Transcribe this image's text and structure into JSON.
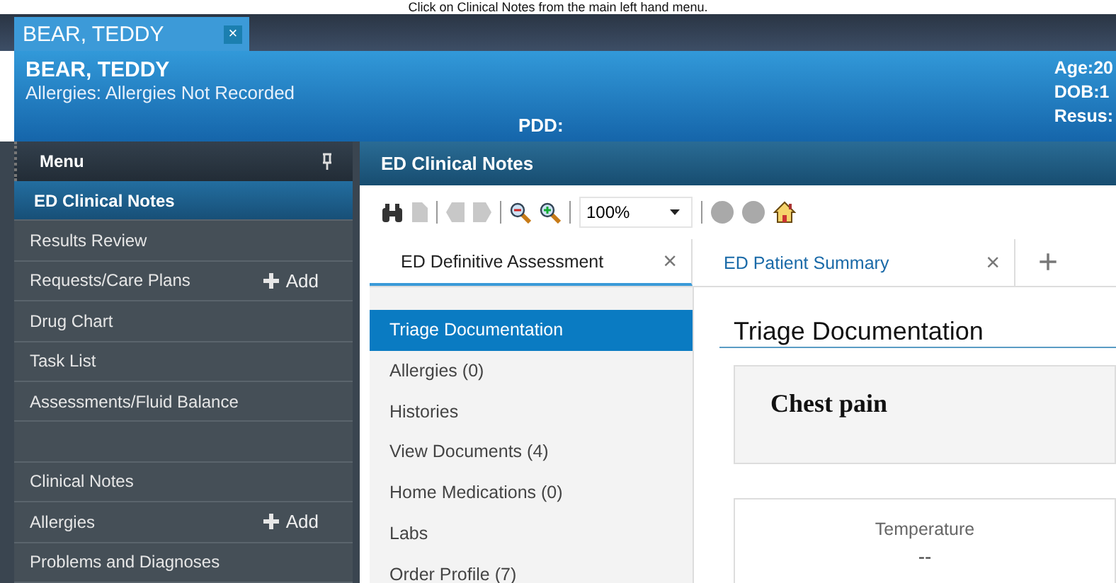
{
  "caption": "Click on Clinical Notes from the main left hand menu.",
  "patient_tab": {
    "label": "BEAR, TEDDY",
    "close": "×"
  },
  "banner": {
    "name": "BEAR, TEDDY",
    "allergies": "Allergies: Allergies Not Recorded",
    "pdd": "PDD:",
    "details": [
      "Age:20",
      "DOB:1",
      "Resus:"
    ]
  },
  "menu": {
    "title": "Menu",
    "groups": [
      {
        "items": [
          {
            "label": "ED Clinical Notes",
            "selected": true
          },
          {
            "label": "Results Review",
            "selected": false
          },
          {
            "label": "Requests/Care Plans",
            "selected": false,
            "add": "Add"
          },
          {
            "label": "Drug Chart",
            "selected": false
          },
          {
            "label": "Task List",
            "selected": false
          },
          {
            "label": "Assessments/Fluid Balance",
            "selected": false
          }
        ]
      },
      {
        "items": [
          {
            "label": "Clinical Notes",
            "selected": false
          },
          {
            "label": "Allergies",
            "selected": false,
            "add": "Add"
          },
          {
            "label": "Problems and Diagnoses",
            "selected": false
          }
        ]
      }
    ]
  },
  "content": {
    "title": "ED Clinical Notes",
    "zoom": "100%",
    "tabs": [
      {
        "label": "ED Definitive Assessment",
        "close": "×",
        "selected": true
      },
      {
        "label": "ED Patient Summary",
        "close": "×",
        "selected": false
      }
    ],
    "new_tab": "+",
    "nav": [
      {
        "label": "Triage Documentation",
        "selected": true
      },
      {
        "label": "Allergies (0)",
        "selected": false
      },
      {
        "label": "Histories",
        "selected": false
      },
      {
        "label": "View Documents (4)",
        "selected": false
      },
      {
        "label": "Home Medications (0)",
        "selected": false
      },
      {
        "label": "Labs",
        "selected": false
      },
      {
        "label": "Order Profile (7)",
        "selected": false
      }
    ],
    "heading": "Triage Documentation",
    "complaint": "Chest pain",
    "vital": {
      "label": "Temperature",
      "value": "--"
    }
  }
}
